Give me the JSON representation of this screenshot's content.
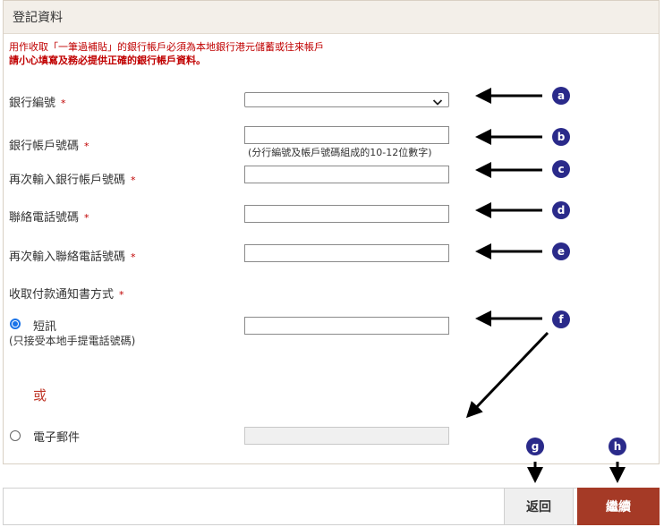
{
  "panel": {
    "title": "登記資料",
    "notice_line1": "用作收取「一筆過補貼」的銀行帳戶必須為本地銀行港元儲蓄或往來帳戶",
    "notice_line2": "請小心填寫及務必提供正確的銀行帳戶資料。"
  },
  "form": {
    "required_mark": "*",
    "bank_code_label": "銀行編號",
    "bank_code_value": "",
    "account_label": "銀行帳戶號碼",
    "account_hint": "(分行編號及帳戶號碼組成的10-12位數字)",
    "account_confirm_label": "再次輸入銀行帳戶號碼",
    "phone_label": "聯絡電話號碼",
    "phone_confirm_label": "再次輸入聯絡電話號碼",
    "notify_method_label": "收取付款通知書方式",
    "sms_label": "短訊",
    "sms_sublabel": "(只接受本地手提電話號碼)",
    "sms_selected": true,
    "or_text": "或",
    "email_label": "電子郵件",
    "email_selected": false
  },
  "actions": {
    "back_label": "返回",
    "continue_label": "繼續"
  },
  "annotations": {
    "markers": [
      "a",
      "b",
      "c",
      "d",
      "e",
      "f",
      "g",
      "h"
    ],
    "marker_color": "#2a2a8a",
    "arrow_color": "#000000"
  },
  "colors": {
    "accent_red": "#c00000",
    "continue_button": "#a53a26",
    "radio_blue": "#1a73e8"
  }
}
